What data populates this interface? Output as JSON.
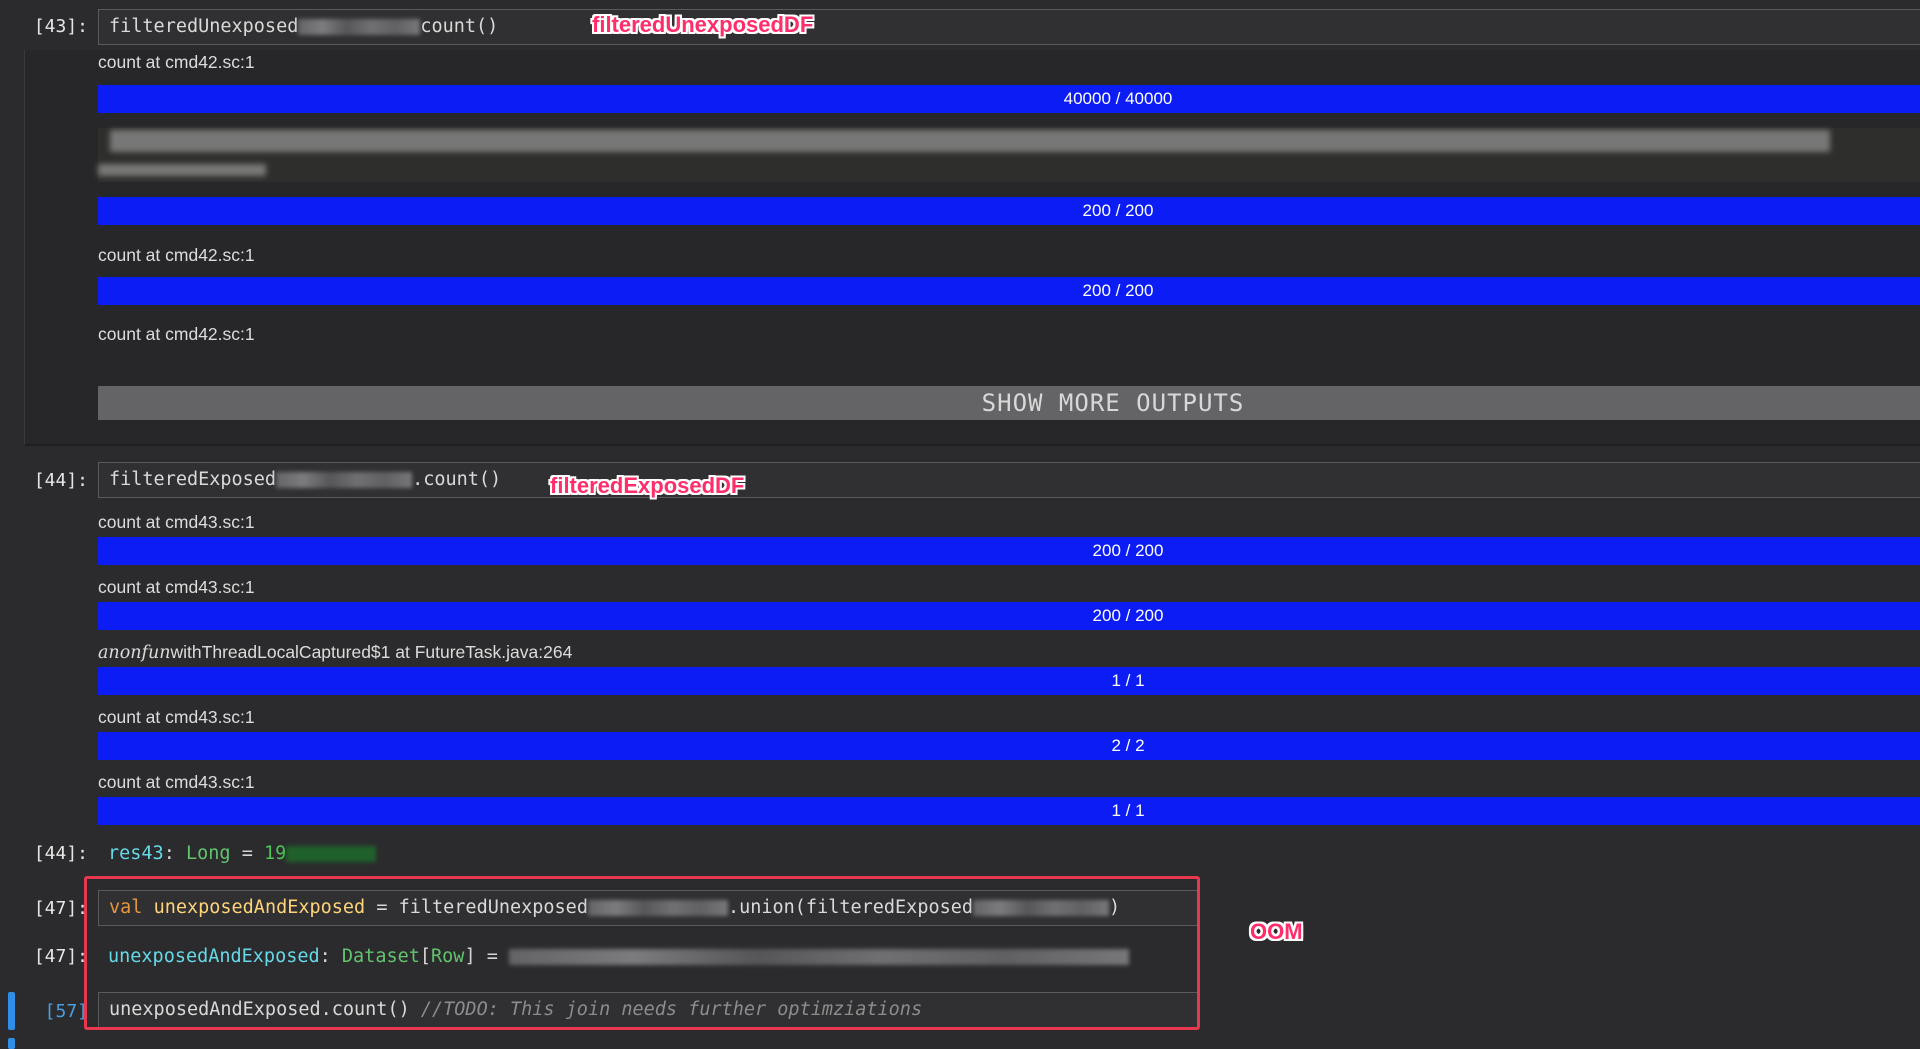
{
  "cells": {
    "c43": {
      "prompt": "[43]:",
      "code_prefix": "filteredUnexposed",
      "code_suffix": "count()",
      "annotation": "filteredUnexposedDF",
      "jobs": [
        {
          "label": "count at cmd42.sc:1",
          "progress": "40000 / 40000",
          "fraction": 1.0
        },
        {
          "label": "",
          "progress": "200 / 200",
          "fraction": 1.0
        },
        {
          "label": "count at cmd42.sc:1",
          "progress": "200 / 200",
          "fraction": 1.0
        },
        {
          "label": "count at cmd42.sc:1"
        }
      ],
      "show_more": "SHOW MORE OUTPUTS"
    },
    "c44": {
      "prompt": "[44]:",
      "code_prefix": "filteredExposed",
      "code_suffix": ".count()",
      "annotation": "filteredExposedDF",
      "jobs": [
        {
          "label": "count at cmd43.sc:1",
          "progress": "200 / 200",
          "fraction": 1.0
        },
        {
          "label": "count at cmd43.sc:1",
          "progress": "200 / 200",
          "fraction": 1.0
        },
        {
          "label_math": "anonfun",
          "label": "withThreadLocalCaptured$1 at FutureTask.java:264",
          "progress": "1 / 1",
          "fraction": 1.0
        },
        {
          "label": "count at cmd43.sc:1",
          "progress": "2 / 2",
          "fraction": 1.0
        },
        {
          "label": "count at cmd43.sc:1",
          "progress": "1 / 1",
          "fraction": 1.0
        }
      ],
      "result_prompt": "[44]:",
      "result_name": "res43",
      "result_colon": ":",
      "result_type": "Long",
      "result_eq": "=",
      "result_value": "19"
    },
    "c47": {
      "prompt": "[47]:",
      "kw": "val",
      "ident": "unexposedAndExposed",
      "eq": "=",
      "expr_a": "filteredUnexposed",
      "expr_b": ".union(filteredExposed",
      "expr_c": ")",
      "result_prompt": "[47]:",
      "result_name": "unexposedAndExposed",
      "result_colon": ":",
      "result_type": "Dataset",
      "result_type_param": "Row",
      "result_eq": "="
    },
    "c57": {
      "prompt": "[57]",
      "code": "unexposedAndExposed.count()",
      "comment": "//TODO: This join needs further optimziations"
    }
  },
  "annotations": {
    "oom": "OOM"
  },
  "colors": {
    "progress_fill": "#0b1cf4",
    "annotation": "#ff2e6a",
    "oom_box": "#e8384f"
  }
}
